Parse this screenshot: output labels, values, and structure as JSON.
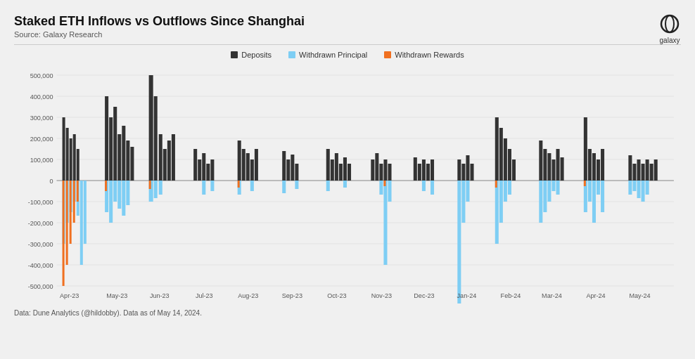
{
  "title": "Staked ETH Inflows vs Outflows Since Shanghai",
  "subtitle": "Source: Galaxy Research",
  "logo_text": "galaxy",
  "legend": [
    {
      "label": "Deposits",
      "color": "#333333"
    },
    {
      "label": "Withdrawn Principal",
      "color": "#7ecef4"
    },
    {
      "label": "Withdrawn Rewards",
      "color": "#f07020"
    }
  ],
  "y_axis": {
    "labels": [
      "500,000",
      "400,000",
      "300,000",
      "200,000",
      "100,000",
      "0",
      "-100,000",
      "-200,000",
      "-300,000",
      "-400,000",
      "-500,000"
    ]
  },
  "x_axis": {
    "labels": [
      "Apr-23",
      "May-23",
      "Jun-23",
      "Jul-23",
      "Aug-23",
      "Sep-23",
      "Oct-23",
      "Nov-23",
      "Dec-23",
      "Jan-24",
      "Feb-24",
      "Mar-24",
      "Apr-24",
      "May-24"
    ]
  },
  "footer": "Data: Dune Analytics (@hildobby). Data as of May 14, 2024."
}
